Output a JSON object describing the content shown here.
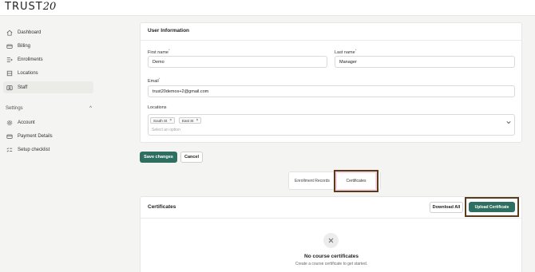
{
  "brand": {
    "logo_main": "TRUST",
    "logo_script": "20"
  },
  "sidebar": {
    "items": [
      {
        "label": "Dashboard",
        "icon": "home-icon"
      },
      {
        "label": "Billing",
        "icon": "billing-icon"
      },
      {
        "label": "Enrollments",
        "icon": "enrollments-icon"
      },
      {
        "label": "Locations",
        "icon": "locations-icon"
      },
      {
        "label": "Staff",
        "icon": "staff-icon",
        "active": true
      }
    ],
    "settings_heading": "Settings",
    "settings_chevron": "^",
    "settings_items": [
      {
        "label": "Account",
        "icon": "gear-icon"
      },
      {
        "label": "Payment Details",
        "icon": "card-icon"
      },
      {
        "label": "Setup checklist",
        "icon": "checklist-icon"
      }
    ]
  },
  "user_info": {
    "title": "User Information",
    "first_name_label": "First name",
    "first_name_value": "Demo",
    "last_name_label": "Last name",
    "last_name_value": "Manager",
    "email_label": "Email",
    "email_value": "trust20demos+2@gmail.com",
    "locations_label": "Locations",
    "locations_chips": [
      "South St",
      "East St"
    ],
    "locations_placeholder": "Select an option",
    "required_mark": "*"
  },
  "actions": {
    "save": "Save changes",
    "cancel": "Cancel"
  },
  "tabs": {
    "enrollment": "Enrollment Records",
    "certificates": "Certificates"
  },
  "certificates": {
    "title": "Certificates",
    "download_all": "Download All",
    "upload": "Upload Certificate",
    "empty_title": "No course certificates",
    "empty_subtitle": "Create a course certificate to get started."
  },
  "colors": {
    "primary": "#2f6f62",
    "highlight_border": "#5c3a1c",
    "tab_highlight_bg": "#f3d8e4"
  }
}
